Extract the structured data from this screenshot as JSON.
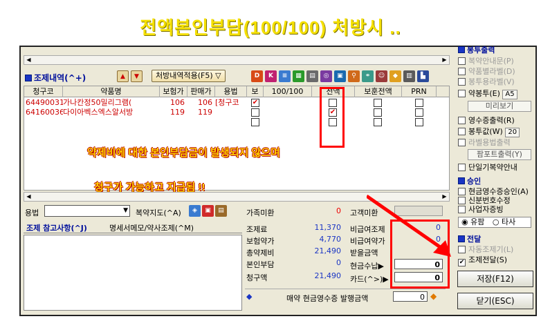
{
  "caption_top": "전액본인부담(100/100) 처방시 ..",
  "note_line1": "약제비에 대한 본인부담금이 발생되지 않으며",
  "note_line2": "청구가 가능하고 지급됨 !!",
  "section": {
    "title": "조제내역(^+)",
    "prescription_button": "처방내역적용(F5)"
  },
  "grid": {
    "headers": [
      "청구코",
      "약품명",
      "보험가",
      "판매가",
      "용법",
      "보",
      "100/100",
      "전액",
      "보훈전액",
      "PRN"
    ],
    "rows": [
      {
        "code": "64490031",
        "name": "가나칸정50밀리그램(",
        "insured_price": "106",
        "sale_price": "106",
        "usage": "[청구코"
      },
      {
        "code": "64160036",
        "name": "다이아벡스엑스알서방",
        "insured_price": "119",
        "sale_price": "119",
        "usage": ""
      }
    ]
  },
  "usage_row": {
    "label": "용법",
    "guide_label": "복약지도(^A)"
  },
  "tabs": {
    "memo_tab": "조제 참고사항(^J)",
    "detail_tab": "명세서메모/약사조제(^M)"
  },
  "summary": {
    "family_label": "가족미환",
    "family_value": "0",
    "customer_label": "고객미환",
    "dispensing_fee_label": "조제료",
    "dispensing_fee": "11,370",
    "non_pay_fee_label": "비급여조제",
    "non_pay_fee": "0",
    "insured_drug_label": "보험약가",
    "insured_drug": "4,770",
    "non_pay_drug_label": "비급여약가",
    "non_pay_drug": "0",
    "total_label": "총약제비",
    "total": "21,490",
    "receive_label": "받을금액",
    "receive": "0",
    "copay_label": "본인부담",
    "copay": "0",
    "cash_label": "현금수납▶",
    "cash": "0",
    "claim_label": "청구액",
    "claim": "21,490",
    "card_label": "카드(^>)▶",
    "card": "0",
    "receipt_label": "매약 현금영수증 발행금액",
    "receipt": "0"
  },
  "right_panel": {
    "top_header": "봉투출력",
    "items_top": [
      "복약안내문(P)",
      "약품별라벨(D)",
      "봉투용라벨(V)"
    ],
    "envelope_label": "약봉투(E)",
    "envelope_size": "A5",
    "preview_button": "미리보기",
    "receipt_print": "영수증출력(R)",
    "bag_label": "봉투값(W)",
    "bag_value": "20",
    "usage_label_print": "라벨용법출력",
    "popfot_button": "팜포트출력(Y)",
    "unit_dose": "단일기복약안내",
    "approve_header": "승인",
    "approve_items": [
      "현금영수증승인(A)",
      "신분번호수정",
      "사업자증빙"
    ],
    "radio_paid": "유팜",
    "radio_other": "타사",
    "transfer_header": "전달",
    "auto_transfer": "자동조제기(L)",
    "dispense_transfer": "조제전달(S)",
    "save_button": "저장(F12)",
    "close_button": "닫기(ESC)"
  }
}
